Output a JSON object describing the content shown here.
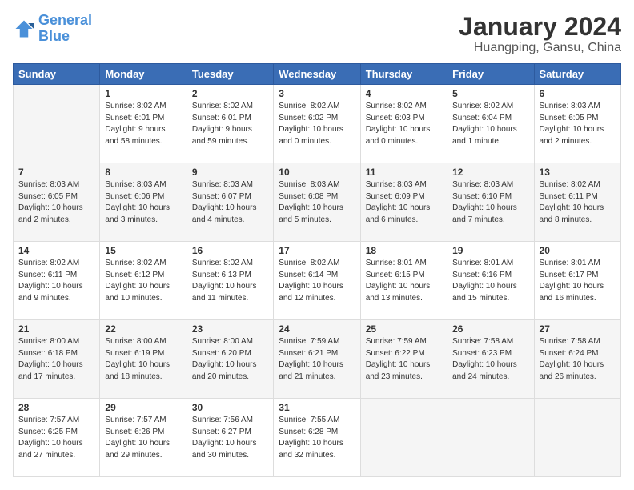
{
  "logo": {
    "line1": "General",
    "line2": "Blue"
  },
  "title": "January 2024",
  "subtitle": "Huangping, Gansu, China",
  "days_of_week": [
    "Sunday",
    "Monday",
    "Tuesday",
    "Wednesday",
    "Thursday",
    "Friday",
    "Saturday"
  ],
  "weeks": [
    [
      {
        "day": "",
        "info": ""
      },
      {
        "day": "1",
        "info": "Sunrise: 8:02 AM\nSunset: 6:01 PM\nDaylight: 9 hours\nand 58 minutes."
      },
      {
        "day": "2",
        "info": "Sunrise: 8:02 AM\nSunset: 6:01 PM\nDaylight: 9 hours\nand 59 minutes."
      },
      {
        "day": "3",
        "info": "Sunrise: 8:02 AM\nSunset: 6:02 PM\nDaylight: 10 hours\nand 0 minutes."
      },
      {
        "day": "4",
        "info": "Sunrise: 8:02 AM\nSunset: 6:03 PM\nDaylight: 10 hours\nand 0 minutes."
      },
      {
        "day": "5",
        "info": "Sunrise: 8:02 AM\nSunset: 6:04 PM\nDaylight: 10 hours\nand 1 minute."
      },
      {
        "day": "6",
        "info": "Sunrise: 8:03 AM\nSunset: 6:05 PM\nDaylight: 10 hours\nand 2 minutes."
      }
    ],
    [
      {
        "day": "7",
        "info": "Sunrise: 8:03 AM\nSunset: 6:05 PM\nDaylight: 10 hours\nand 2 minutes."
      },
      {
        "day": "8",
        "info": "Sunrise: 8:03 AM\nSunset: 6:06 PM\nDaylight: 10 hours\nand 3 minutes."
      },
      {
        "day": "9",
        "info": "Sunrise: 8:03 AM\nSunset: 6:07 PM\nDaylight: 10 hours\nand 4 minutes."
      },
      {
        "day": "10",
        "info": "Sunrise: 8:03 AM\nSunset: 6:08 PM\nDaylight: 10 hours\nand 5 minutes."
      },
      {
        "day": "11",
        "info": "Sunrise: 8:03 AM\nSunset: 6:09 PM\nDaylight: 10 hours\nand 6 minutes."
      },
      {
        "day": "12",
        "info": "Sunrise: 8:03 AM\nSunset: 6:10 PM\nDaylight: 10 hours\nand 7 minutes."
      },
      {
        "day": "13",
        "info": "Sunrise: 8:02 AM\nSunset: 6:11 PM\nDaylight: 10 hours\nand 8 minutes."
      }
    ],
    [
      {
        "day": "14",
        "info": "Sunrise: 8:02 AM\nSunset: 6:11 PM\nDaylight: 10 hours\nand 9 minutes."
      },
      {
        "day": "15",
        "info": "Sunrise: 8:02 AM\nSunset: 6:12 PM\nDaylight: 10 hours\nand 10 minutes."
      },
      {
        "day": "16",
        "info": "Sunrise: 8:02 AM\nSunset: 6:13 PM\nDaylight: 10 hours\nand 11 minutes."
      },
      {
        "day": "17",
        "info": "Sunrise: 8:02 AM\nSunset: 6:14 PM\nDaylight: 10 hours\nand 12 minutes."
      },
      {
        "day": "18",
        "info": "Sunrise: 8:01 AM\nSunset: 6:15 PM\nDaylight: 10 hours\nand 13 minutes."
      },
      {
        "day": "19",
        "info": "Sunrise: 8:01 AM\nSunset: 6:16 PM\nDaylight: 10 hours\nand 15 minutes."
      },
      {
        "day": "20",
        "info": "Sunrise: 8:01 AM\nSunset: 6:17 PM\nDaylight: 10 hours\nand 16 minutes."
      }
    ],
    [
      {
        "day": "21",
        "info": "Sunrise: 8:00 AM\nSunset: 6:18 PM\nDaylight: 10 hours\nand 17 minutes."
      },
      {
        "day": "22",
        "info": "Sunrise: 8:00 AM\nSunset: 6:19 PM\nDaylight: 10 hours\nand 18 minutes."
      },
      {
        "day": "23",
        "info": "Sunrise: 8:00 AM\nSunset: 6:20 PM\nDaylight: 10 hours\nand 20 minutes."
      },
      {
        "day": "24",
        "info": "Sunrise: 7:59 AM\nSunset: 6:21 PM\nDaylight: 10 hours\nand 21 minutes."
      },
      {
        "day": "25",
        "info": "Sunrise: 7:59 AM\nSunset: 6:22 PM\nDaylight: 10 hours\nand 23 minutes."
      },
      {
        "day": "26",
        "info": "Sunrise: 7:58 AM\nSunset: 6:23 PM\nDaylight: 10 hours\nand 24 minutes."
      },
      {
        "day": "27",
        "info": "Sunrise: 7:58 AM\nSunset: 6:24 PM\nDaylight: 10 hours\nand 26 minutes."
      }
    ],
    [
      {
        "day": "28",
        "info": "Sunrise: 7:57 AM\nSunset: 6:25 PM\nDaylight: 10 hours\nand 27 minutes."
      },
      {
        "day": "29",
        "info": "Sunrise: 7:57 AM\nSunset: 6:26 PM\nDaylight: 10 hours\nand 29 minutes."
      },
      {
        "day": "30",
        "info": "Sunrise: 7:56 AM\nSunset: 6:27 PM\nDaylight: 10 hours\nand 30 minutes."
      },
      {
        "day": "31",
        "info": "Sunrise: 7:55 AM\nSunset: 6:28 PM\nDaylight: 10 hours\nand 32 minutes."
      },
      {
        "day": "",
        "info": ""
      },
      {
        "day": "",
        "info": ""
      },
      {
        "day": "",
        "info": ""
      }
    ]
  ]
}
